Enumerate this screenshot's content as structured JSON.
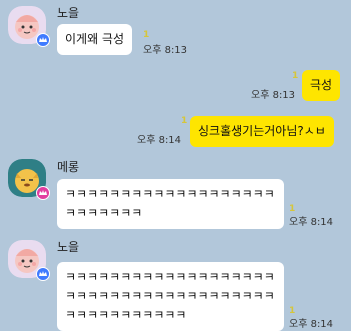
{
  "messages": [
    {
      "sender": "노을",
      "text": "이게왜 극성",
      "time": "오후 8:13",
      "unread": "1"
    },
    {
      "text": "극성",
      "time": "오후 8:13",
      "unread": "1"
    },
    {
      "text": "싱크홀생기는거아님?ㅅㅂ",
      "time": "오후 8:14",
      "unread": "1"
    },
    {
      "sender": "메롱",
      "text": "ㅋㅋㅋㅋㅋㅋㅋㅋㅋㅋㅋㅋㅋㅋㅋㅋㅋㅋㅋㅋㅋㅋㅋㅋㅋㅋ",
      "time": "오후 8:14",
      "unread": "1"
    },
    {
      "sender": "노을",
      "text": "ㅋㅋㅋㅋㅋㅋㅋㅋㅋㅋㅋㅋㅋㅋㅋㅋㅋㅋㅋㅋㅋㅋㅋㅋㅋㅋㅋㅋㅋㅋㅋㅋㅋㅋㅋㅋㅋㅋㅋㅋㅋㅋㅋㅋㅋㅋㅋㅋㅋ",
      "time": "오후 8:14",
      "unread": "1"
    }
  ],
  "colors": {
    "background": "#b2c7da",
    "my_bubble": "#fee500",
    "other_bubble": "#ffffff",
    "unread": "#d6c63a",
    "badge_blue": "#3f7bff",
    "badge_pink": "#e23da0"
  },
  "icons": {
    "avatar_noeul": "pink-character-avatar",
    "avatar_merong": "yellow-character-avatar",
    "badge": "crown-badge-icon"
  }
}
